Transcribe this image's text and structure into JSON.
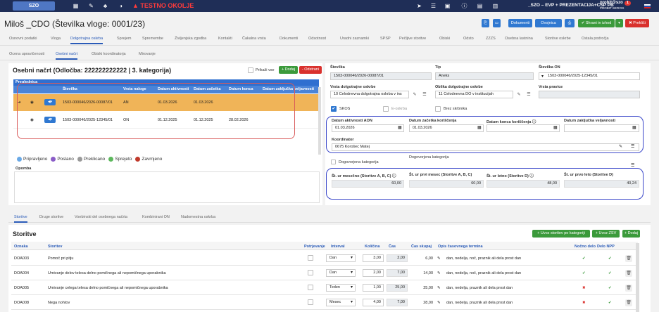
{
  "topbar": {
    "logo": "SZO",
    "testno": "TESTNO OKOLJE",
    "context": "_SZO – EVP + PREZENTACIJA+CSP PB",
    "user": "probit@szo",
    "user_sub": "PROBIT SERVIS",
    "badge": "1"
  },
  "header": {
    "title": "Miloš _CDO (Številka vloge: 0001/23)",
    "buttons": {
      "dokumenti": "Dokumenti",
      "ovojnice": "Ovojnica",
      "shrani": "✔ Shrani in izhod",
      "preklici": "✖ Prekliči"
    }
  },
  "tabs": [
    "Osnovni podatki",
    "Vloga",
    "Dolgotrajna oskrba",
    "Sprejem",
    "Spremembe",
    "Življenjska zgodba",
    "Kontakti",
    "Čakalna vrsta",
    "Dokumenti",
    "Odsotnost",
    "Uradni zaznamki",
    "SPSP",
    "Pečljive storitve",
    "Obiski",
    "Odsto",
    "ZZZS",
    "Osebna lastnina",
    "Storitve oskrbe",
    "Ostala področja"
  ],
  "subtabs": [
    "Ocena upravičenosti",
    "Osebni načrt",
    "Obiski koordinatorja",
    "Mirovanje"
  ],
  "plan": {
    "title": "Osebni načrt (Odločba: 222222222222 | 3. kategorija)",
    "prikazi_vse": "Prikaži vse",
    "dodaj": "+ Dodaj",
    "odstrani": "- Odstrani",
    "grid_label": "Preglednica",
    "columns": [
      "Številka",
      "Vrsta naloge",
      "Datum aktivnosti",
      "Datum začetka",
      "Datum konca",
      "Datum zaključka veljavnosti"
    ],
    "rows": [
      {
        "stevilka": "1503-000046/2026-00087/01",
        "vrsta": "AN",
        "aktivnost": "01.03.2026",
        "zacetek": "01.03.2026",
        "konec": "",
        "zakljucek": ""
      },
      {
        "stevilka": "1503-000046/2025-12345/01",
        "vrsta": "ON",
        "aktivnost": "01.12.2025",
        "zacetek": "01.12.2025",
        "konec": "28.02.2026",
        "zakljucek": ""
      }
    ],
    "legend": [
      "Pripravljeno",
      "Poslano",
      "Preklicano",
      "Sprejeto",
      "Zavrnjeno"
    ],
    "legend_colors": [
      "#6aa9e6",
      "#8a5cc7",
      "#999999",
      "#5cb85c",
      "#c0392b"
    ],
    "opomba_label": "Opomba"
  },
  "detail": {
    "stevilka_label": "Številka",
    "stevilka": "1503-000046/2026-00087/01",
    "tip_label": "Tip",
    "tip": "Aneks",
    "stevilka_on_label": "Številka ON",
    "stevilka_on": "1503-000046/2025-12345/01",
    "vrsta_label": "Vrsta dolgotrajne oskrbe",
    "vrsta": "10 Celodnevna dolgotrajna oskrba v ins",
    "oblika_label": "Oblika dolgotrajne oskrbe",
    "oblika": "11 Celodnevna DO v institucijah",
    "vrsta_pravice_label": "Vrsta pravice",
    "skos": "SKOS",
    "eoskrba": "E-oskrba",
    "brez": "Brez skrbnika",
    "d_aktivnosti_label": "Datum aktivnosti AON",
    "d_aktivnosti": "01.03.2026",
    "d_zacetka_label": "Datum začetka koriščenja",
    "d_zacetka": "01.03.2026",
    "d_konca_label": "Datum konca koriščenja",
    "d_zakljucka_label": "Datum zaključka veljavnosti",
    "koordinator_label": "Koordinator",
    "koordinator": "0675 Korošec Matej",
    "dogovorjena": "Dogovorjena kategorija",
    "dogovorjena2": "Dogovorjena kategorija",
    "st_mesecno_label": "Št. ur mesečno (Storitve A, B, C)",
    "st_mesecno": "60,00",
    "st_prvi_label": "Št. ur prvi mesec (Storitve A, B, C)",
    "st_prvi": "60,00",
    "st_letno_label": "Št. ur letno (Storitve D)",
    "st_letno": "48,00",
    "st_prvo_label": "Št. ur prvo leto (Storitve D)",
    "st_prvo": "40,24"
  },
  "bottom_tabs": [
    "Storitve",
    "Druge storitve",
    "Vsebinski del osebnega načrta",
    "Kombinirani ON",
    "Nadomestna oskrba"
  ],
  "services": {
    "title": "Storitve",
    "btn_kat": "+ Uvoz storitev po kategoriji",
    "btn_zsv": "+ Uvoz ZSV",
    "btn_dodaj": "+ Dodaj",
    "columns": [
      "Oznaka",
      "Storitev",
      "Potrjevanje",
      "Interval",
      "Količina",
      "Čas",
      "Čas skupaj",
      "Opis časovnega termina",
      "Nočno delo",
      "Delo NPP"
    ],
    "rows": [
      {
        "oznaka": "DOA003",
        "storitev": "Pomoč pri pitju",
        "interval": "Dan",
        "kolicina": "3,00",
        "cas": "2,00",
        "skupaj": "6,00",
        "opis": "dan, nedelja, noč, praznik ali dela prost dan",
        "nocno": "✔",
        "npp": "✔",
        "nocno_color": "#3b9a3b"
      },
      {
        "oznaka": "DOA004",
        "storitev": "Umivanje delov telesa delno pomičnega ali nepomičnega uporabnika",
        "interval": "Dan",
        "kolicina": "2,00",
        "cas": "7,00",
        "skupaj": "14,00",
        "opis": "dan, nedelja, noč, praznik ali dela prost dan",
        "nocno": "✔",
        "npp": "✔",
        "nocno_color": "#3b9a3b"
      },
      {
        "oznaka": "DOA005",
        "storitev": "Umivanje celega telesa delno pomičnega ali nepomičnega uporabnika",
        "interval": "Teden",
        "kolicina": "1,00",
        "cas": "25,00",
        "skupaj": "25,00",
        "opis": "dan, nedelja, praznik ali dela prost dan",
        "nocno": "✖",
        "npp": "✔",
        "nocno_color": "#d9312d"
      },
      {
        "oznaka": "DOA008",
        "storitev": "Nega nohtov",
        "interval": "Mesec",
        "kolicina": "4,00",
        "cas": "7,00",
        "skupaj": "28,00",
        "opis": "dan, nedelja, praznik ali dela prost dan",
        "nocno": "✖",
        "npp": "✔",
        "nocno_color": "#d9312d"
      }
    ]
  }
}
